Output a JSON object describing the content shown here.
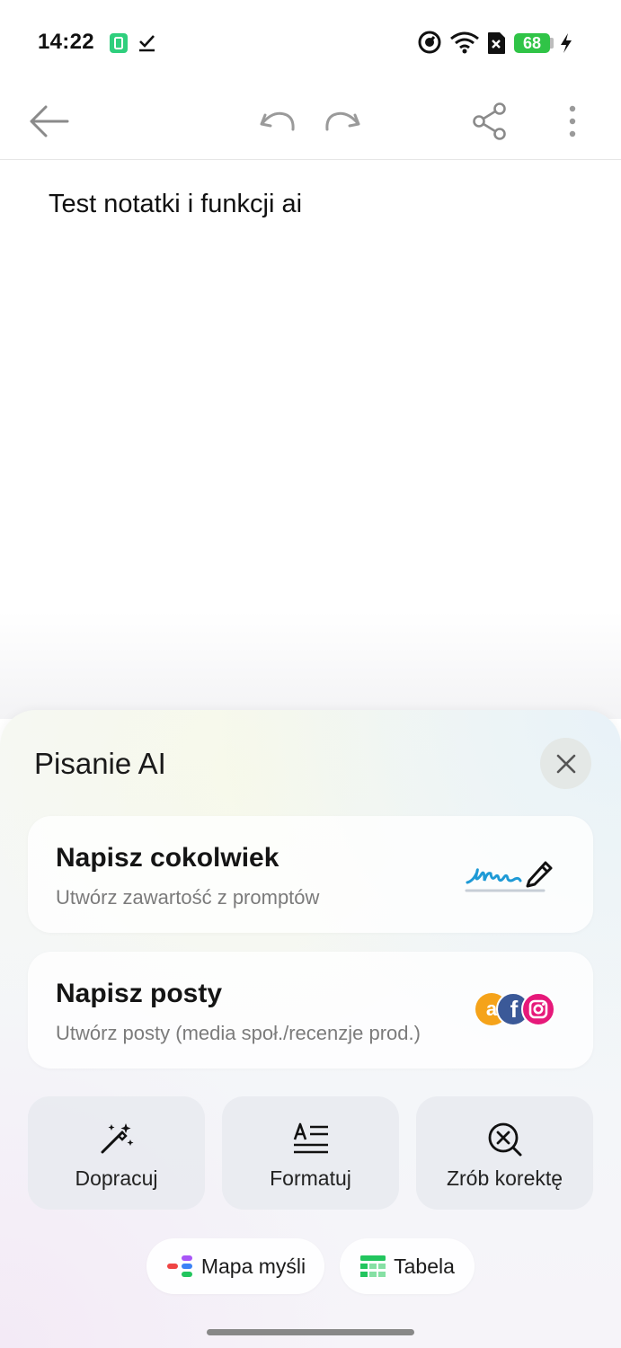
{
  "status_bar": {
    "time": "14:22",
    "battery": "68",
    "icons": [
      "sim-card-icon",
      "download-done-icon",
      "data-saver-icon",
      "wifi-icon",
      "no-sim-icon",
      "battery-icon",
      "charging-bolt-icon"
    ]
  },
  "toolbar": {
    "icons": [
      "back-arrow-icon",
      "undo-icon",
      "redo-icon",
      "share-icon",
      "more-vert-icon"
    ]
  },
  "note": {
    "text": "Test notatki i funkcji ai"
  },
  "ai_sheet": {
    "title": "Pisanie AI",
    "cards": [
      {
        "title": "Napisz cokolwiek",
        "subtitle": "Utwórz zawartość z promptów",
        "icon": "signature-pen-icon"
      },
      {
        "title": "Napisz posty",
        "subtitle": "Utwórz posty (media społ./recenzje prod.)",
        "icon": "social-media-icons"
      }
    ],
    "actions": [
      {
        "label": "Dopracuj",
        "icon": "magic-wand-icon"
      },
      {
        "label": "Formatuj",
        "icon": "text-format-icon"
      },
      {
        "label": "Zrób korektę",
        "icon": "proofread-icon"
      }
    ],
    "chips": [
      {
        "label": "Mapa myśli",
        "icon": "mind-map-icon"
      },
      {
        "label": "Tabela",
        "icon": "table-icon"
      }
    ]
  },
  "colors": {
    "battery_green": "#30c447",
    "amazon_orange": "#f5a31a",
    "facebook_blue": "#3b5998",
    "instagram_pink": "#e6197a",
    "signature_blue": "#1e9ad6"
  }
}
